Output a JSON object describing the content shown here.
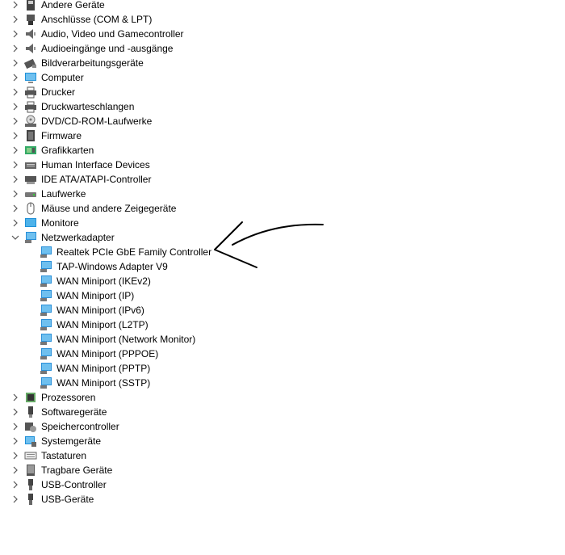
{
  "tree": [
    {
      "label": "Andere Geräte",
      "icon": "unknown-device-icon",
      "expanded": false
    },
    {
      "label": "Anschlüsse (COM & LPT)",
      "icon": "port-icon",
      "expanded": false
    },
    {
      "label": "Audio, Video und Gamecontroller",
      "icon": "speaker-icon",
      "expanded": false
    },
    {
      "label": "Audioeingänge und -ausgänge",
      "icon": "speaker-icon",
      "expanded": false
    },
    {
      "label": "Bildverarbeitungsgeräte",
      "icon": "camera-icon",
      "expanded": false
    },
    {
      "label": "Computer",
      "icon": "computer-icon",
      "expanded": false
    },
    {
      "label": "Drucker",
      "icon": "printer-icon",
      "expanded": false
    },
    {
      "label": "Druckwarteschlangen",
      "icon": "printer-icon",
      "expanded": false
    },
    {
      "label": "DVD/CD-ROM-Laufwerke",
      "icon": "disc-drive-icon",
      "expanded": false
    },
    {
      "label": "Firmware",
      "icon": "firmware-icon",
      "expanded": false
    },
    {
      "label": "Grafikkarten",
      "icon": "display-adapter-icon",
      "expanded": false
    },
    {
      "label": "Human Interface Devices",
      "icon": "hid-icon",
      "expanded": false
    },
    {
      "label": "IDE ATA/ATAPI-Controller",
      "icon": "ide-controller-icon",
      "expanded": false
    },
    {
      "label": "Laufwerke",
      "icon": "disk-drive-icon",
      "expanded": false
    },
    {
      "label": "Mäuse und andere Zeigegeräte",
      "icon": "mouse-icon",
      "expanded": false
    },
    {
      "label": "Monitore",
      "icon": "monitor-icon",
      "expanded": false
    },
    {
      "label": "Netzwerkadapter",
      "icon": "network-adapter-icon",
      "expanded": true,
      "children": [
        "Realtek PCIe GbE Family Controller",
        "TAP-Windows Adapter V9",
        "WAN Miniport (IKEv2)",
        "WAN Miniport (IP)",
        "WAN Miniport (IPv6)",
        "WAN Miniport (L2TP)",
        "WAN Miniport (Network Monitor)",
        "WAN Miniport (PPPOE)",
        "WAN Miniport (PPTP)",
        "WAN Miniport (SSTP)"
      ]
    },
    {
      "label": "Prozessoren",
      "icon": "processor-icon",
      "expanded": false
    },
    {
      "label": "Softwaregeräte",
      "icon": "software-device-icon",
      "expanded": false
    },
    {
      "label": "Speichercontroller",
      "icon": "storage-controller-icon",
      "expanded": false
    },
    {
      "label": "Systemgeräte",
      "icon": "system-device-icon",
      "expanded": false
    },
    {
      "label": "Tastaturen",
      "icon": "keyboard-icon",
      "expanded": false
    },
    {
      "label": "Tragbare Geräte",
      "icon": "portable-device-icon",
      "expanded": false
    },
    {
      "label": "USB-Controller",
      "icon": "usb-icon",
      "expanded": false
    },
    {
      "label": "USB-Geräte",
      "icon": "usb-icon",
      "expanded": false
    }
  ],
  "colors": {
    "monitor_blue": "#1e90d8",
    "network_blue": "#2a8fd8",
    "gray": "#555555",
    "arrow": "#000000"
  }
}
